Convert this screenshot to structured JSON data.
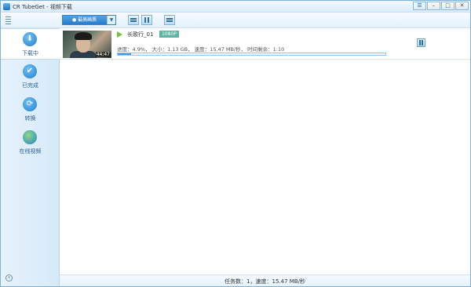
{
  "window": {
    "title": "CR TubeGet - 视频下载",
    "controls": [
      "menu",
      "minimize",
      "maximize",
      "close"
    ]
  },
  "toolbar": {
    "menu_icon": "hamburger-menu-icon",
    "quality_select_value": "● 最高画质",
    "buttons": [
      "pause-all",
      "start-all",
      "clear"
    ]
  },
  "sidebar": {
    "items": [
      {
        "label": "下载中",
        "icon": "download-icon",
        "active": true
      },
      {
        "label": "已完成",
        "icon": "check-icon",
        "active": false
      },
      {
        "label": "转换",
        "icon": "convert-icon",
        "active": false
      },
      {
        "label": "在线视频",
        "icon": "globe-icon",
        "active": false
      }
    ]
  },
  "tasks": [
    {
      "title": "长歌行_01",
      "resolution": "1080P",
      "duration": "44:47",
      "status_text": "进度：4.9%， 大小：1.13 GB， 速度：15.47 MB/秒， 时间剩余：1:10",
      "progress": 0.049
    }
  ],
  "statusbar": {
    "text": "任务数：1，速度：15.47 MB/秒"
  },
  "colors": {
    "accent": "#2a7cc9",
    "sidebar_bg": "#dcecf9",
    "badge": "#5bb6a1"
  }
}
